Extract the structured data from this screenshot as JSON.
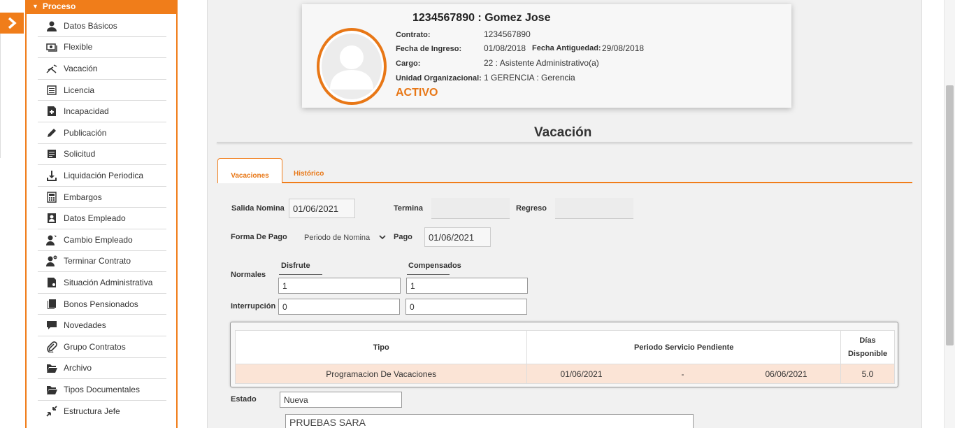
{
  "sidebar": {
    "header": "Proceso",
    "items": [
      {
        "label": "Datos Básicos"
      },
      {
        "label": "Flexible"
      },
      {
        "label": "Vacación"
      },
      {
        "label": "Licencia"
      },
      {
        "label": "Incapacidad"
      },
      {
        "label": "Publicación"
      },
      {
        "label": "Solicitud"
      },
      {
        "label": "Liquidación Periodica"
      },
      {
        "label": "Embargos"
      },
      {
        "label": "Datos Empleado"
      },
      {
        "label": "Cambio Empleado"
      },
      {
        "label": "Terminar Contrato"
      },
      {
        "label": "Situación Administrativa"
      },
      {
        "label": "Bonos Pensionados"
      },
      {
        "label": "Novedades"
      },
      {
        "label": "Grupo Contratos"
      },
      {
        "label": "Archivo"
      },
      {
        "label": "Tipos Documentales"
      },
      {
        "label": "Estructura Jefe"
      }
    ]
  },
  "employee": {
    "name": "1234567890 : Gomez Jose",
    "contrato_label": "Contrato:",
    "contrato": "1234567890",
    "ingreso_label": "Fecha de Ingreso:",
    "ingreso": "01/08/2018",
    "antiguedad_label": "Fecha Antiguedad:",
    "antiguedad": "29/08/2018",
    "cargo_label": "Cargo:",
    "cargo": "22 : Asistente Administrativo(a)",
    "unidad_label": "Unidad Organizacional:",
    "unidad": "1 GERENCIA : Gerencia",
    "status": "ACTIVO"
  },
  "section_title": "Vacación",
  "tabs": [
    {
      "label": "Vacaciones"
    },
    {
      "label": "Histórico"
    }
  ],
  "form": {
    "salida_label": "Salida Nomina",
    "salida_value": "01/06/2021",
    "termina_label": "Termina",
    "termina_value": "",
    "regreso_label": "Regreso",
    "regreso_value": "",
    "forma_pago_label": "Forma De Pago",
    "forma_pago_value": "Periodo de Nomina",
    "pago_label": "Pago",
    "pago_value": "01/06/2021",
    "disfrute_header": "Disfrute",
    "compensados_header": "Compensados",
    "normales_label": "Normales",
    "normales_disfrute": "1",
    "normales_compensados": "1",
    "interrupcion_label": "Interrupción",
    "interrupcion_disfrute": "0",
    "interrupcion_compensados": "0",
    "estado_label": "Estado",
    "estado_value": "Nueva",
    "observacion_value": "PRUEBAS SARA"
  },
  "table": {
    "headers": [
      "Tipo",
      "Periodo Servicio Pendiente",
      "Días Disponible"
    ],
    "rows": [
      {
        "tipo": "Programacion De Vacaciones",
        "desde": "01/06/2021",
        "sep": "-",
        "hasta": "06/06/2021",
        "dias": "5.0"
      }
    ]
  },
  "colors": {
    "accent": "#f07d1a",
    "row_highlight": "#fbe4d6",
    "panel_bg": "#f1f1f1"
  },
  "icons": {
    "toggle": "chevron-right-icon"
  }
}
